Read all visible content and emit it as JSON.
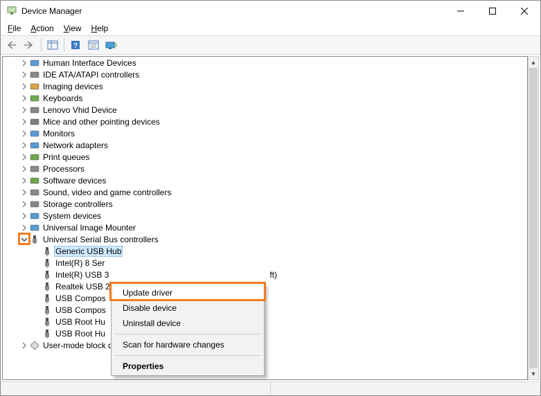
{
  "window": {
    "title": "Device Manager"
  },
  "menus": {
    "file": "File",
    "action": "Action",
    "view": "View",
    "help": "Help"
  },
  "tree": {
    "collapsed": [
      "Human Interface Devices",
      "IDE ATA/ATAPI controllers",
      "Imaging devices",
      "Keyboards",
      "Lenovo Vhid Device",
      "Mice and other pointing devices",
      "Monitors",
      "Network adapters",
      "Print queues",
      "Processors",
      "Software devices",
      "Sound, video and game controllers",
      "Storage controllers",
      "System devices",
      "Universal Image Mounter"
    ],
    "expanded": {
      "label": "Universal Serial Bus controllers",
      "children": [
        "Generic USB Hub",
        "Intel(R) 8 Ser",
        "Intel(R) USB 3",
        "Realtek USB 2",
        "USB Compos",
        "USB Compos",
        "USB Root Hu",
        "USB Root Hu"
      ],
      "ft_suffix": "ft)"
    },
    "tail": "User-mode block device"
  },
  "context_menu": {
    "update": "Update driver",
    "disable": "Disable device",
    "uninstall": "Uninstall device",
    "scan": "Scan for hardware changes",
    "properties": "Properties"
  }
}
